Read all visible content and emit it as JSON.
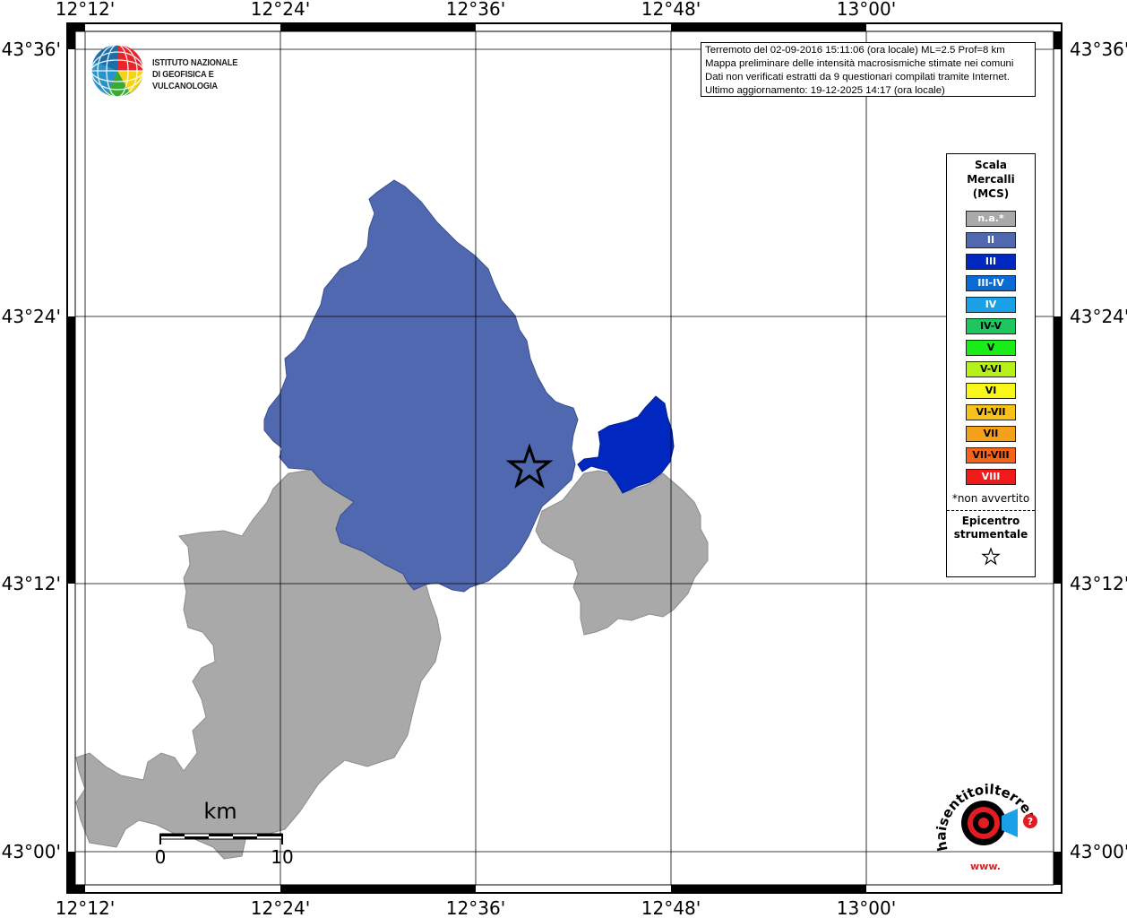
{
  "map": {
    "lon_ticks_top": [
      "12°12'",
      "12°24'",
      "12°36'",
      "12°48'",
      "13°00'"
    ],
    "lon_ticks_bottom": [
      "12°12'",
      "12°24'",
      "12°36'",
      "12°48'",
      "13°00'"
    ],
    "lat_ticks_left": [
      "43°36'",
      "43°24'",
      "43°12'",
      "43°00'"
    ],
    "lat_ticks_right": [
      "43°36'",
      "43°24'",
      "43°12'",
      "43°00'"
    ],
    "scalebar": {
      "unit": "km",
      "min": "0",
      "max": "10"
    }
  },
  "header": {
    "org_line1": "ISTITUTO NAZIONALE",
    "org_line2": "DI GEOFISICA E VULCANOLOGIA"
  },
  "info": {
    "line1": "Terremoto del 02-09-2016 15:11:06 (ora locale) ML=2.5 Prof=8 km",
    "line2": "Mappa preliminare delle intensità macrosismiche stimate nei comuni",
    "line3": "Dati non verificati estratti da 9 questionari compilati tramite Internet.",
    "line4": "Ultimo aggiornamento: 19-12-2025 14:17 (ora locale)"
  },
  "legend": {
    "title1": "Scala",
    "title2": "Mercalli",
    "title3": "(MCS)",
    "items": [
      {
        "label": "n.a.*",
        "color": "#a9a9a9",
        "text_color": "#ffffff"
      },
      {
        "label": "II",
        "color": "#4f68b0",
        "text_color": "#ffffff"
      },
      {
        "label": "III",
        "color": "#0028c0",
        "text_color": "#ffffff"
      },
      {
        "label": "III-IV",
        "color": "#0a6ad6",
        "text_color": "#ffffff"
      },
      {
        "label": "IV",
        "color": "#1aa0e6",
        "text_color": "#ffffff"
      },
      {
        "label": "IV-V",
        "color": "#1fc660",
        "text_color": "#000000"
      },
      {
        "label": "V",
        "color": "#19ec19",
        "text_color": "#000000"
      },
      {
        "label": "V-VI",
        "color": "#b6f01a",
        "text_color": "#000000"
      },
      {
        "label": "VI",
        "color": "#f7f71a",
        "text_color": "#000000"
      },
      {
        "label": "VI-VII",
        "color": "#f6c21a",
        "text_color": "#000000"
      },
      {
        "label": "VII",
        "color": "#f5a01a",
        "text_color": "#000000"
      },
      {
        "label": "VII-VIII",
        "color": "#f5641a",
        "text_color": "#000000"
      },
      {
        "label": "VIII",
        "color": "#f01a1a",
        "text_color": "#ffffff"
      }
    ],
    "note": "*non avvertito",
    "epicenter1": "Epicentro",
    "epicenter2": "strumentale"
  },
  "footer_logo": {
    "text": "haisentitoilterremoto.it",
    "prefix": "www."
  },
  "colors": {
    "na": "#a9a9a9",
    "intensity_II": "#4f68b0",
    "intensity_III": "#0028c0"
  }
}
